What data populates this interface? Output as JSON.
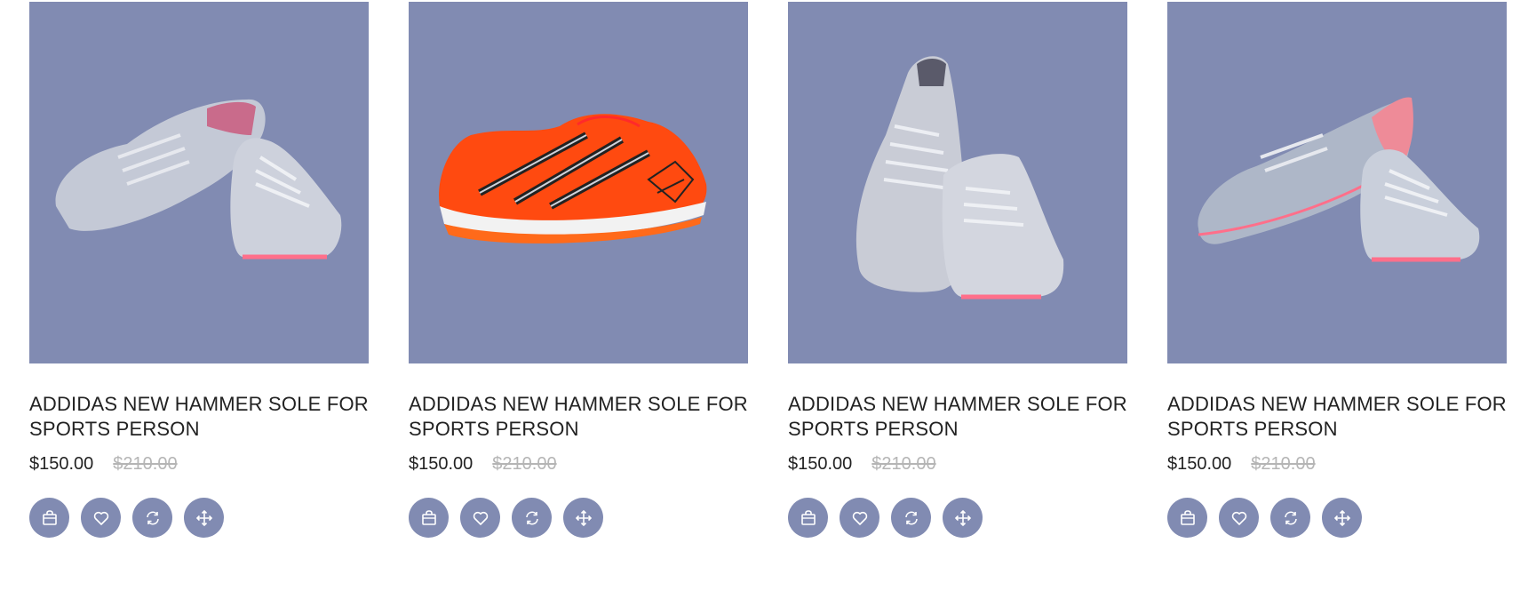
{
  "products": [
    {
      "title": "ADDIDAS NEW HAMMER SOLE FOR SPORTS PERSON",
      "price": "$150.00",
      "old_price": "$210.00",
      "image": "grey-suede-sneaker-pair-side"
    },
    {
      "title": "ADDIDAS NEW HAMMER SOLE FOR SPORTS PERSON",
      "price": "$150.00",
      "old_price": "$210.00",
      "image": "orange-running-shoe"
    },
    {
      "title": "ADDIDAS NEW HAMMER SOLE FOR SPORTS PERSON",
      "price": "$150.00",
      "old_price": "$210.00",
      "image": "grey-suede-sneaker-pair-front"
    },
    {
      "title": "ADDIDAS NEW HAMMER SOLE FOR SPORTS PERSON",
      "price": "$150.00",
      "old_price": "$210.00",
      "image": "grey-pink-sneaker-pair"
    }
  ],
  "action_icons": [
    "cart-icon",
    "heart-icon",
    "refresh-icon",
    "move-icon"
  ],
  "colors": {
    "thumb_bg": "#818bb2",
    "button_bg": "#818bb2",
    "title": "#222222",
    "old_price": "#b5b5b5"
  }
}
